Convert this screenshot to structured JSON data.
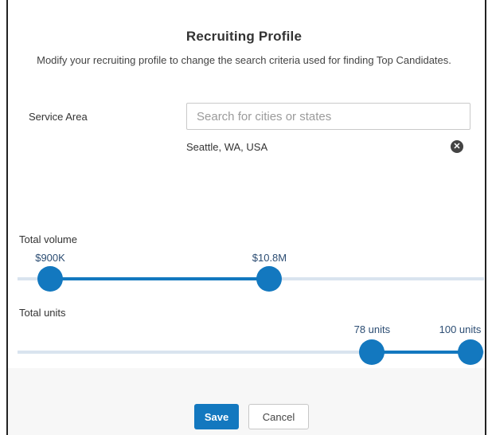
{
  "header": {
    "title": "Recruiting Profile",
    "subtitle": "Modify your recruiting profile to change the search criteria used for finding Top Candidates."
  },
  "service_area": {
    "label": "Service Area",
    "placeholder": "Search for cities or states",
    "value": "",
    "selected": [
      "Seattle, WA, USA"
    ],
    "remove_icon": "circle-x-icon"
  },
  "total_volume": {
    "label": "Total volume",
    "min_label": "$900K",
    "max_label": "$10.8M",
    "min_fraction": 0.07,
    "max_fraction": 0.54
  },
  "total_units": {
    "label": "Total units",
    "min_label": "78 units",
    "max_label": "100 units",
    "min_fraction": 0.76,
    "max_fraction": 1.0
  },
  "footer": {
    "save_label": "Save",
    "cancel_label": "Cancel"
  },
  "colors": {
    "accent": "#1378bf",
    "track": "#d9e4ef"
  }
}
